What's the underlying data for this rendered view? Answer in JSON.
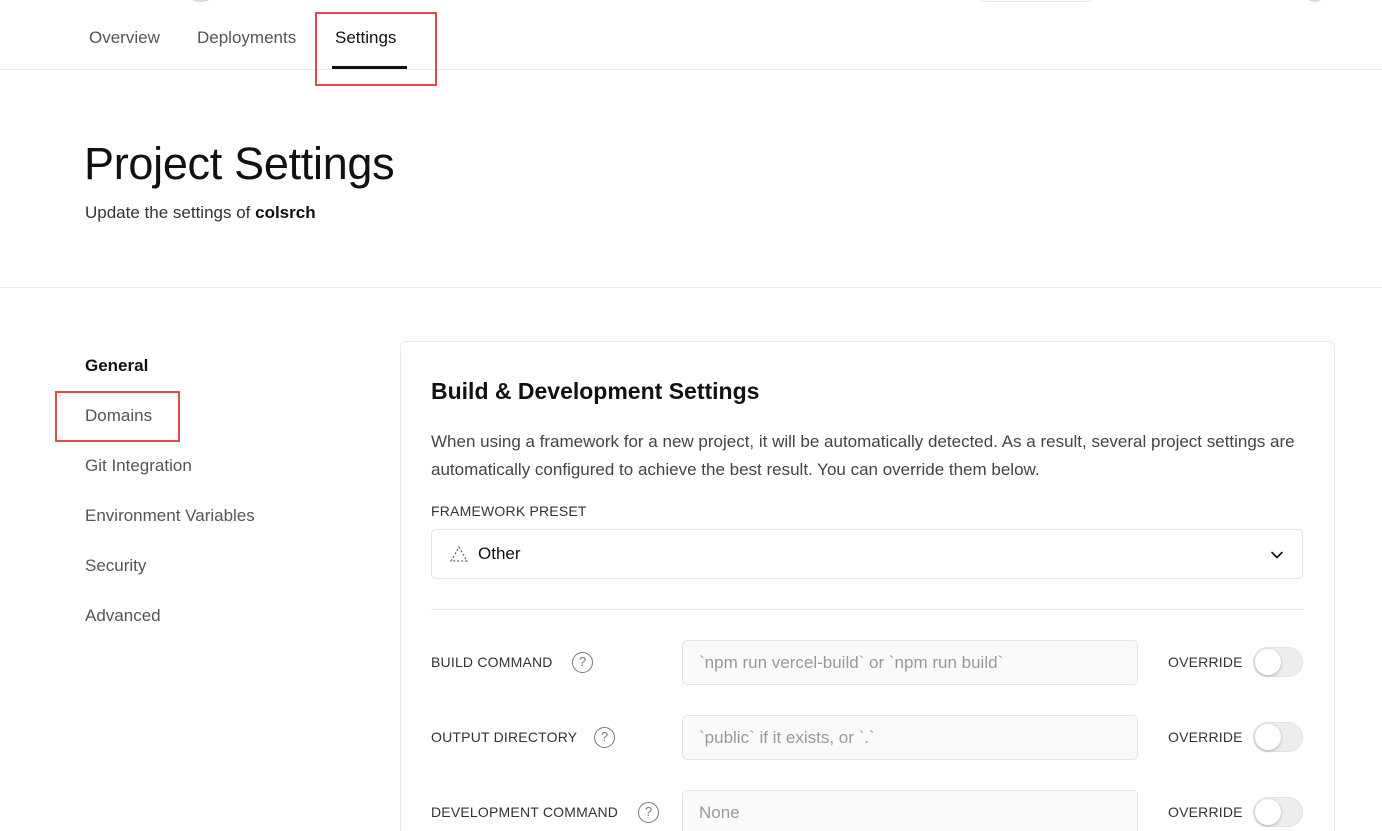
{
  "top_nav": {
    "tabs": [
      {
        "label": "Overview"
      },
      {
        "label": "Deployments"
      },
      {
        "label": "Settings",
        "active": true
      }
    ]
  },
  "header": {
    "title": "Project Settings",
    "subtitle_prefix": "Update the settings of",
    "project_name": "colsrch"
  },
  "sidebar": {
    "items": [
      {
        "label": "General",
        "active": true
      },
      {
        "label": "Domains"
      },
      {
        "label": "Git Integration"
      },
      {
        "label": "Environment Variables"
      },
      {
        "label": "Security"
      },
      {
        "label": "Advanced"
      }
    ]
  },
  "build_settings": {
    "title": "Build & Development Settings",
    "description": "When using a framework for a new project, it will be automatically detected. As a result, several project settings are automatically configured to achieve the best result. You can override them below.",
    "framework_preset": {
      "label": "FRAMEWORK PRESET",
      "value": "Other",
      "icon": "triangle-dotted-icon"
    },
    "fields": [
      {
        "label": "BUILD COMMAND",
        "placeholder": "`npm run vercel-build` or `npm run build`",
        "override_label": "OVERRIDE",
        "override_on": false
      },
      {
        "label": "OUTPUT DIRECTORY",
        "placeholder": "`public` if it exists, or `.`",
        "override_label": "OVERRIDE",
        "override_on": false
      },
      {
        "label": "DEVELOPMENT COMMAND",
        "placeholder": "None",
        "override_label": "OVERRIDE",
        "override_on": false
      }
    ],
    "help_glyph": "?"
  },
  "colors": {
    "accent_text": "#111111",
    "muted_text": "#555555",
    "border": "#eaeaea",
    "highlight": "#e5484d",
    "toggle_off": "#ededed"
  }
}
